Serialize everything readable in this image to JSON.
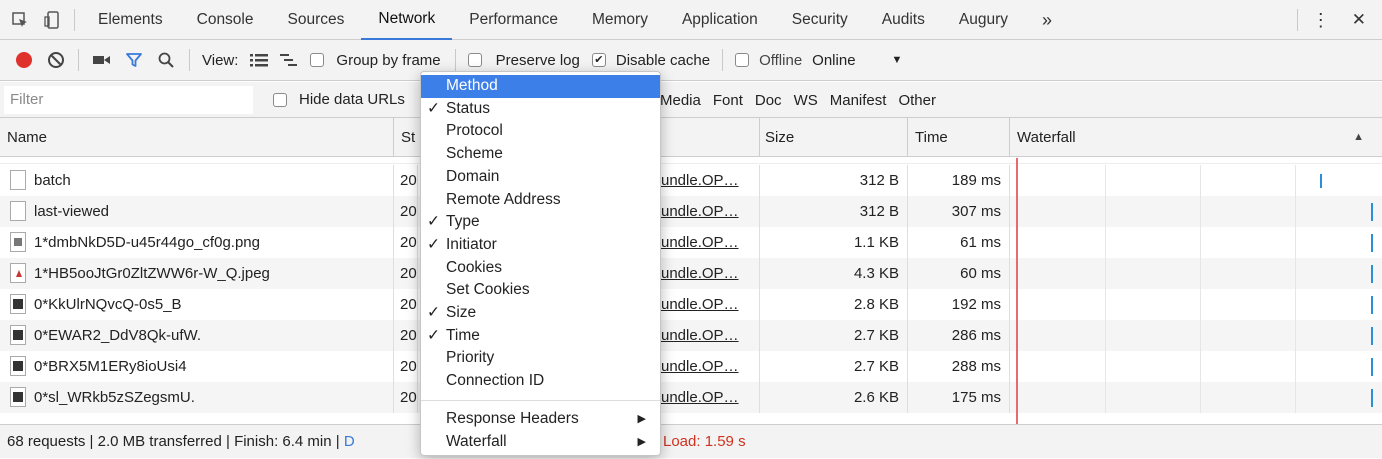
{
  "tabs": {
    "items": [
      "Elements",
      "Console",
      "Sources",
      "Network",
      "Performance",
      "Memory",
      "Application",
      "Security",
      "Audits",
      "Augury"
    ],
    "active_index": 3,
    "more_label": "»",
    "kebab_label": "⋮",
    "close_label": "✕"
  },
  "toolbar": {
    "view_label": "View:",
    "group_by_frame_label": "Group by frame",
    "group_by_frame_checked": false,
    "preserve_log_label": "Preserve log",
    "preserve_log_checked": false,
    "disable_cache_label": "Disable cache",
    "disable_cache_checked": true,
    "offline_label": "Offline",
    "offline_checked": false,
    "throttle_value": "Online",
    "throttle_arrow": "▼",
    "record_color": "#e0322c",
    "accent_color": "#3879d9"
  },
  "filterbar": {
    "placeholder": "Filter",
    "hide_data_urls_label": "Hide data URLs",
    "types": [
      "Media",
      "Font",
      "Doc",
      "WS",
      "Manifest",
      "Other"
    ]
  },
  "table": {
    "headers": {
      "name": "Name",
      "status": "St",
      "size": "Size",
      "time": "Time",
      "waterfall": "Waterfall",
      "sort_arrow": "▲"
    },
    "rows": [
      {
        "name": "batch",
        "status": "20",
        "initiator": "undle.OP…",
        "size": "312 B",
        "time": "189 ms",
        "icon": "doc"
      },
      {
        "name": "last-viewed",
        "status": "20",
        "initiator": "undle.OP…",
        "size": "312 B",
        "time": "307 ms",
        "icon": "doc"
      },
      {
        "name": "1*dmbNkD5D-u45r44go_cf0g.png",
        "status": "20",
        "initiator": "undle.OP…",
        "size": "1.1 KB",
        "time": "61 ms",
        "icon": "img"
      },
      {
        "name": "1*HB5ooJtGr0ZltZWW6r-W_Q.jpeg",
        "status": "20",
        "initiator": "undle.OP…",
        "size": "4.3 KB",
        "time": "60 ms",
        "icon": "jpeg"
      },
      {
        "name": "0*KkUlrNQvcQ-0s5_B",
        "status": "20",
        "initiator": "undle.OP…",
        "size": "2.8 KB",
        "time": "192 ms",
        "icon": "dark"
      },
      {
        "name": "0*EWAR2_DdV8Qk-ufW.",
        "status": "20",
        "initiator": "undle.OP…",
        "size": "2.7 KB",
        "time": "286 ms",
        "icon": "dark"
      },
      {
        "name": "0*BRX5M1ERy8ioUsi4",
        "status": "20",
        "initiator": "undle.OP…",
        "size": "2.7 KB",
        "time": "288 ms",
        "icon": "dark"
      },
      {
        "name": "0*sl_WRkb5zSZegsmU.",
        "status": "20",
        "initiator": "undle.OP…",
        "size": "2.6 KB",
        "time": "175 ms",
        "icon": "dark"
      }
    ]
  },
  "statusbar": {
    "summary": "68 requests | 2.0 MB transferred | Finish: 6.4 min |",
    "clipped": "D",
    "load": "Load: 1.59 s",
    "load_color": "#d0311f"
  },
  "context_menu": {
    "items": [
      {
        "label": "Method",
        "checked": false,
        "highlighted": true
      },
      {
        "label": "Status",
        "checked": true
      },
      {
        "label": "Protocol",
        "checked": false
      },
      {
        "label": "Scheme",
        "checked": false
      },
      {
        "label": "Domain",
        "checked": false
      },
      {
        "label": "Remote Address",
        "checked": false
      },
      {
        "label": "Type",
        "checked": true
      },
      {
        "label": "Initiator",
        "checked": true
      },
      {
        "label": "Cookies",
        "checked": false
      },
      {
        "label": "Set Cookies",
        "checked": false
      },
      {
        "label": "Size",
        "checked": true
      },
      {
        "label": "Time",
        "checked": true
      },
      {
        "label": "Priority",
        "checked": false
      },
      {
        "label": "Connection ID",
        "checked": false
      }
    ],
    "submenus": [
      {
        "label": "Response Headers",
        "arrow": "▶"
      },
      {
        "label": "Waterfall",
        "arrow": "▶"
      }
    ],
    "check_mark": "✓",
    "highlight_color": "#3d7fe8"
  }
}
